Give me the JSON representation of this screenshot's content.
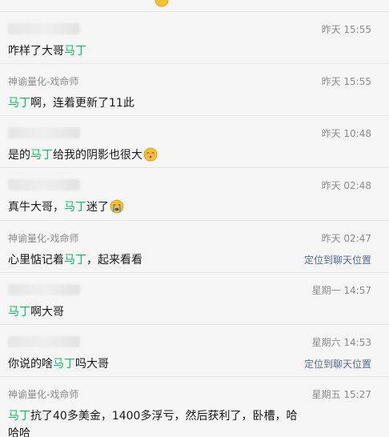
{
  "messages": [
    {
      "sender": "",
      "time": "昨天 15:55",
      "pre": "咋样了大哥",
      "hl": "马丁",
      "post": ""
    },
    {
      "sender": "神谕量化-戏命师",
      "time": "昨天 15:55",
      "pre": "",
      "hl": "马丁",
      "post": "啊，连着更新了11此"
    },
    {
      "sender": "",
      "time": "昨天 10:48",
      "pre": "是的",
      "hl": "马丁",
      "post": "给我的阴影也很大"
    },
    {
      "sender": "",
      "time": "昨天 02:48",
      "pre": "真牛大哥，",
      "hl": "马丁",
      "post": "迷了"
    },
    {
      "sender": "神谕量化-戏命师",
      "time": "昨天 02:47",
      "pre": "心里惦记着",
      "hl": "马丁",
      "post": "，起来看看",
      "jump": "定位到聊天位置"
    },
    {
      "sender": "",
      "time": "星期一 14:57",
      "pre": "",
      "hl": "马丁",
      "post": "啊大哥"
    },
    {
      "sender": "",
      "time": "星期六 14:53",
      "pre": "你说的啥",
      "hl": "马丁",
      "post": "吗大哥",
      "jump": "定位到聊天位置"
    },
    {
      "sender": "神谕量化-戏命师",
      "time": "星期五 15:27",
      "pre": "",
      "hl": "马丁",
      "post": "抗了40多美金，1400多浮亏，然后获利了，卧槽，哈哈哈"
    }
  ]
}
